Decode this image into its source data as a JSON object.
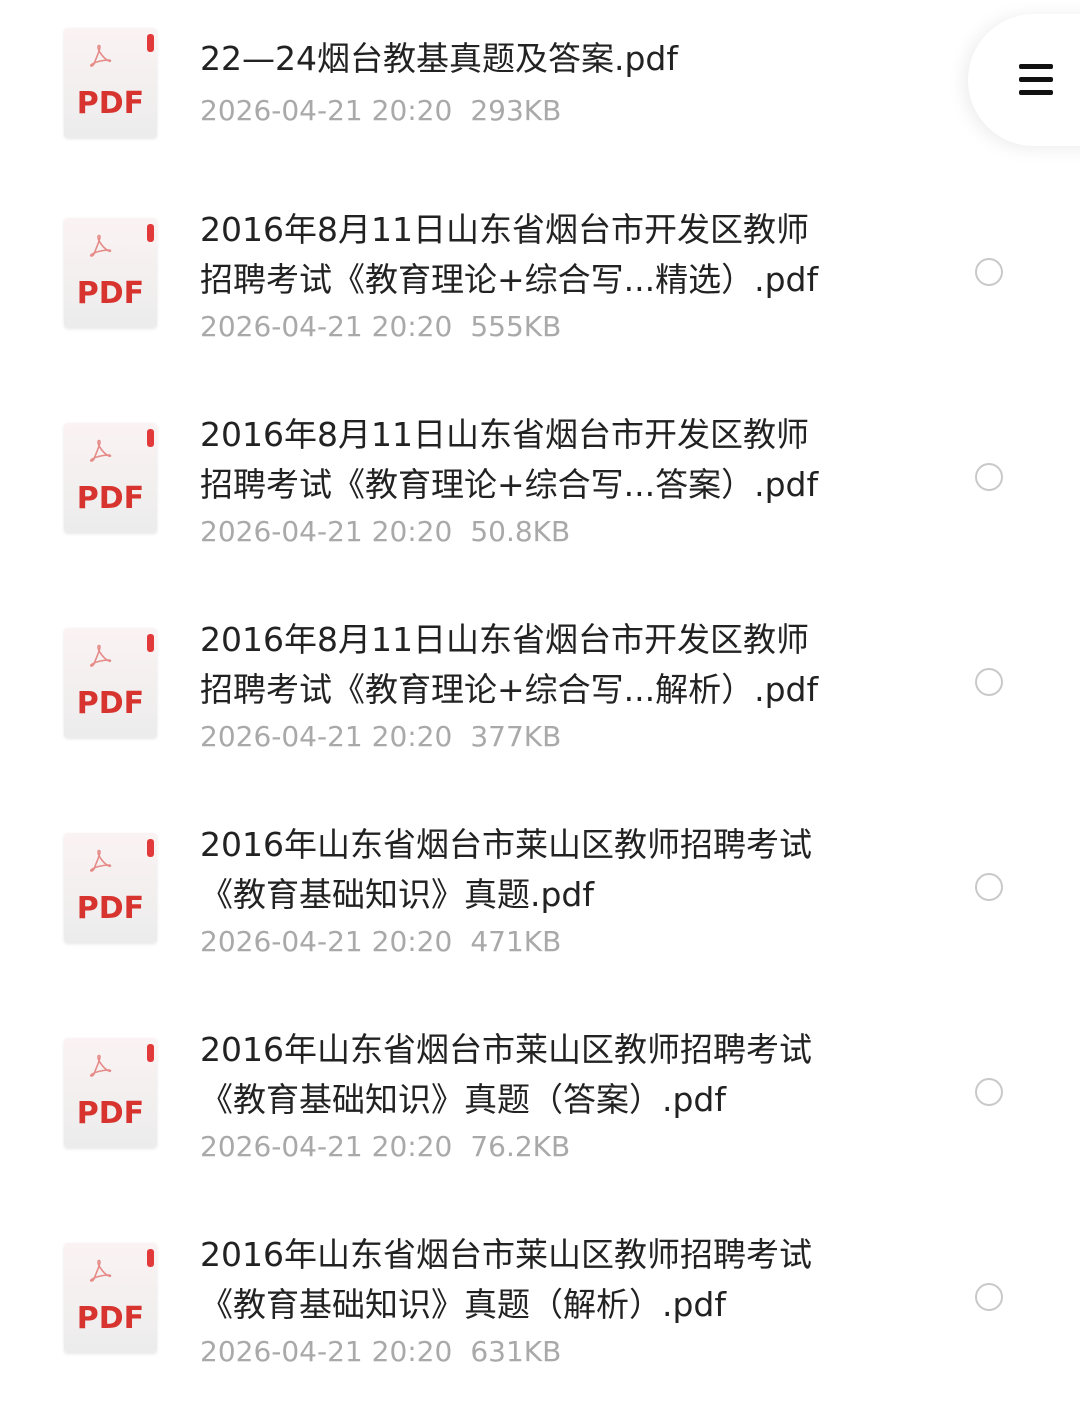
{
  "files": [
    {
      "name": "22—24烟台教基真题及答案.pdf",
      "date": "2026-04-21 20:20",
      "size": "293KB",
      "type_label": "PDF",
      "icon": "pdf-file-icon"
    },
    {
      "name": "2016年8月11日山东省烟台市开发区教师\n招聘考试《教育理论+综合写...精选）.pdf",
      "date": "2026-04-21 20:20",
      "size": "555KB",
      "type_label": "PDF",
      "icon": "pdf-file-icon"
    },
    {
      "name": "2016年8月11日山东省烟台市开发区教师\n招聘考试《教育理论+综合写...答案）.pdf",
      "date": "2026-04-21 20:20",
      "size": "50.8KB",
      "type_label": "PDF",
      "icon": "pdf-file-icon"
    },
    {
      "name": "2016年8月11日山东省烟台市开发区教师\n招聘考试《教育理论+综合写...解析）.pdf",
      "date": "2026-04-21 20:20",
      "size": "377KB",
      "type_label": "PDF",
      "icon": "pdf-file-icon"
    },
    {
      "name": "2016年山东省烟台市莱山区教师招聘考试\n《教育基础知识》真题.pdf",
      "date": "2026-04-21 20:20",
      "size": "471KB",
      "type_label": "PDF",
      "icon": "pdf-file-icon"
    },
    {
      "name": "2016年山东省烟台市莱山区教师招聘考试\n《教育基础知识》真题（答案）.pdf",
      "date": "2026-04-21 20:20",
      "size": "76.2KB",
      "type_label": "PDF",
      "icon": "pdf-file-icon"
    },
    {
      "name": "2016年山东省烟台市莱山区教师招聘考试\n《教育基础知识》真题（解析）.pdf",
      "date": "2026-04-21 20:20",
      "size": "631KB",
      "type_label": "PDF",
      "icon": "pdf-file-icon"
    }
  ],
  "menu": {
    "icon": "hamburger-menu-icon"
  },
  "colors": {
    "pdf_red": "#d8342f",
    "meta_gray": "#a9a9a9",
    "radio_border": "#c9c9c9"
  }
}
